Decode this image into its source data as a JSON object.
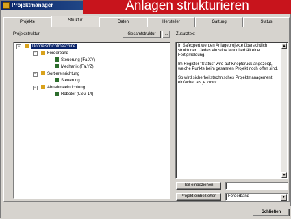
{
  "window": {
    "title": "Projektmanager"
  },
  "overlay_caption": "Anlagen strukturieren",
  "tabs": [
    {
      "label": "Projekte"
    },
    {
      "label": "Struktur"
    },
    {
      "label": "Daten"
    },
    {
      "label": "Hersteller"
    },
    {
      "label": "Gattung"
    },
    {
      "label": "Status"
    }
  ],
  "left": {
    "heading": "Projektstruktur",
    "gesamt_button": "Gesamtstruktur",
    "small_button": "...",
    "tree": [
      {
        "label": "Doppelschichtmaschine",
        "selected": true
      },
      {
        "label": "Förderband"
      },
      {
        "label": "Steuerung (Fa.XY)"
      },
      {
        "label": "Mechanik (Fa.YZ)"
      },
      {
        "label": "Sortiereinrichtung"
      },
      {
        "label": "Steuerung"
      },
      {
        "label": "Abnahmeeinrichtung"
      },
      {
        "label": "Roboter (LSG 14)"
      }
    ]
  },
  "right": {
    "heading": "Zusatztext",
    "note": [
      "In Safexpert werden Anlageprojekte übersichtlich strukturiert. Jedes einzelne Modul erhält eine Fertigmeldung.",
      "Im Register \"Status\" wird auf Knopfdruck angezeigt, welche Punkte beim gesamten Projekt noch offen sind.",
      "So wird sicherheitstechnisches Projektmanagement einfacher als je zuvor."
    ],
    "teil_button": "Teil einbeziehen",
    "teil_input": "",
    "projekt_button": "Projekt einbeziehen",
    "projekt_select": "Förderband"
  },
  "footer": {
    "close_button": "Schließen"
  }
}
